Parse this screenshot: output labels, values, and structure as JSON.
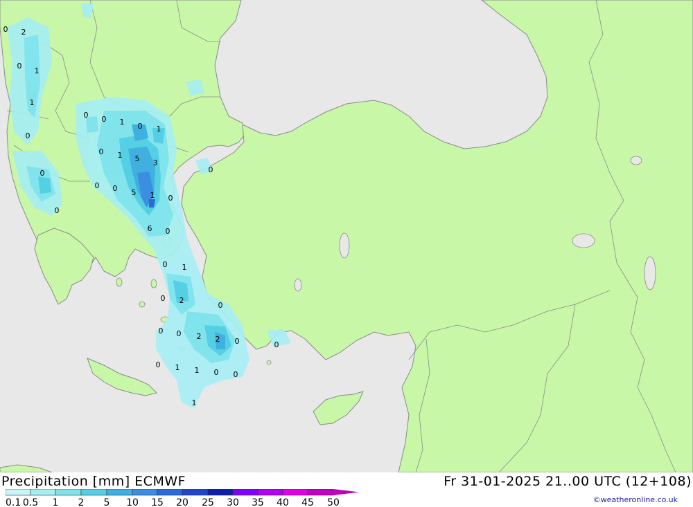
{
  "title_left": "Precipitation [mm] ECMWF",
  "title_right": "Fr 31-01-2025 21..00 UTC (12+108)",
  "credit": "©weatheronline.co.uk",
  "colors": {
    "sea": "#e8e8e8",
    "land": "#c8f7a8",
    "border": "#8a8a8a"
  },
  "legend": {
    "labels": [
      "0.1",
      "0.5",
      "1",
      "2",
      "5",
      "10",
      "15",
      "20",
      "25",
      "30",
      "35",
      "40",
      "45",
      "50"
    ],
    "colors": [
      "#c8f5f8",
      "#a6eef3",
      "#7fe3ec",
      "#55cfe4",
      "#3fb0e0",
      "#3a8fe0",
      "#2a6bd8",
      "#1f47c8",
      "#0f1ea8",
      "#8000ff",
      "#b000f0",
      "#e000e8",
      "#c000c0"
    ]
  },
  "map_values": [
    {
      "text": "0"
    },
    {
      "text": "2"
    },
    {
      "text": "0"
    },
    {
      "text": "1"
    },
    {
      "text": "1"
    },
    {
      "text": "0"
    },
    {
      "text": "0"
    },
    {
      "text": "0"
    },
    {
      "text": "0"
    },
    {
      "text": "0"
    },
    {
      "text": "1"
    },
    {
      "text": "0"
    },
    {
      "text": "1"
    },
    {
      "text": "0"
    },
    {
      "text": "1"
    },
    {
      "text": "5"
    },
    {
      "text": "3"
    },
    {
      "text": "0"
    },
    {
      "text": "0"
    },
    {
      "text": "0"
    },
    {
      "text": "5"
    },
    {
      "text": "1"
    },
    {
      "text": "0"
    },
    {
      "text": "6"
    },
    {
      "text": "0"
    },
    {
      "text": "0"
    },
    {
      "text": "1"
    },
    {
      "text": "0"
    },
    {
      "text": "2"
    },
    {
      "text": "0"
    },
    {
      "text": "0"
    },
    {
      "text": "0"
    },
    {
      "text": "2"
    },
    {
      "text": "2"
    },
    {
      "text": "0"
    },
    {
      "text": "0"
    },
    {
      "text": "0"
    },
    {
      "text": "1"
    },
    {
      "text": "1"
    },
    {
      "text": "0"
    },
    {
      "text": "0"
    },
    {
      "text": "1"
    }
  ]
}
